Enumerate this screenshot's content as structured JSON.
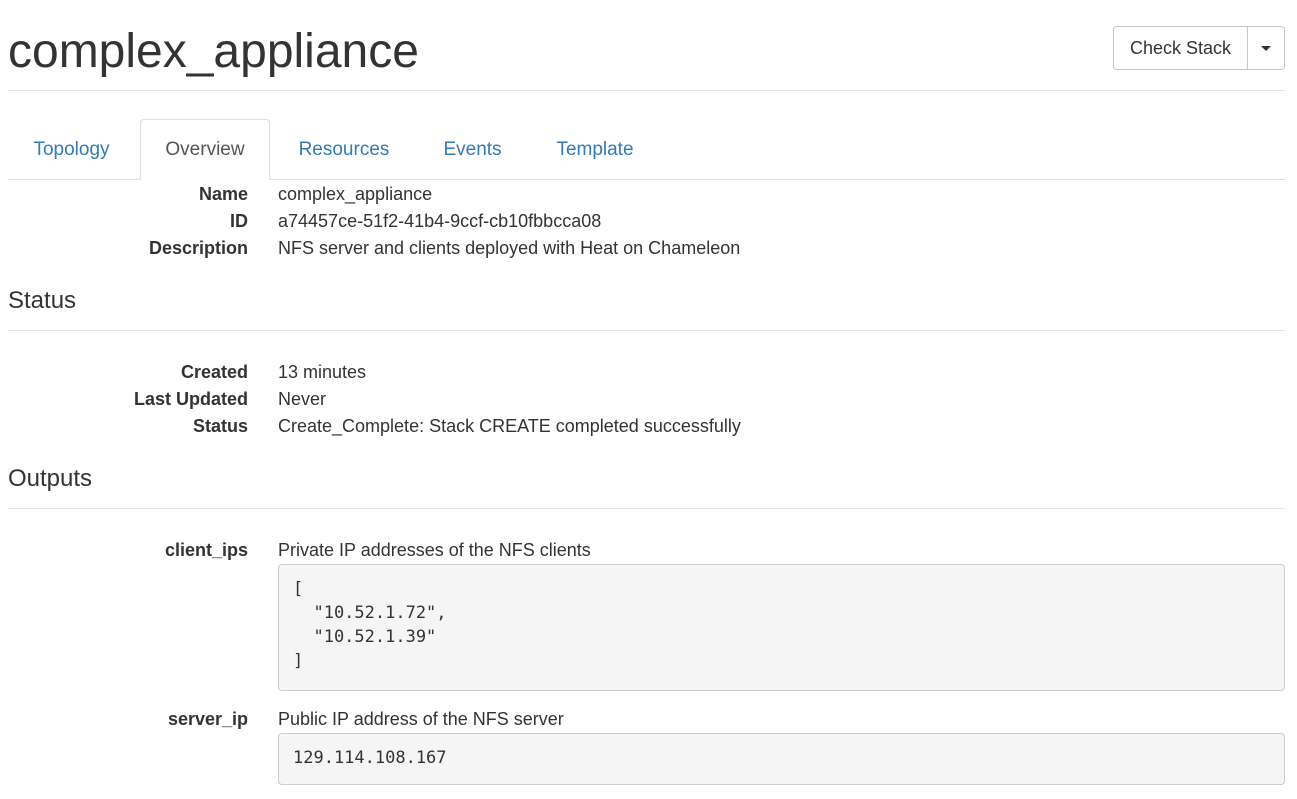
{
  "page": {
    "title": "complex_appliance"
  },
  "actions": {
    "check_stack_label": "Check Stack"
  },
  "tabs": [
    {
      "label": "Topology",
      "active": false
    },
    {
      "label": "Overview",
      "active": true
    },
    {
      "label": "Resources",
      "active": false
    },
    {
      "label": "Events",
      "active": false
    },
    {
      "label": "Template",
      "active": false
    }
  ],
  "info": {
    "name_label": "Name",
    "name": "complex_appliance",
    "id_label": "ID",
    "id": "a74457ce-51f2-41b4-9ccf-cb10fbbcca08",
    "description_label": "Description",
    "description": "NFS server and clients deployed with Heat on Chameleon"
  },
  "status_section": {
    "title": "Status",
    "created_label": "Created",
    "created": "13 minutes",
    "last_updated_label": "Last Updated",
    "last_updated": "Never",
    "status_label": "Status",
    "status": "Create_Complete: Stack CREATE completed successfully"
  },
  "outputs_section": {
    "title": "Outputs",
    "items": [
      {
        "key": "client_ips",
        "description": "Private IP addresses of the NFS clients",
        "value": "[\n  \"10.52.1.72\",\n  \"10.52.1.39\"\n]"
      },
      {
        "key": "server_ip",
        "description": "Public IP address of the NFS server",
        "value": "129.114.108.167"
      }
    ]
  },
  "colors": {
    "link": "#337ab7",
    "text": "#333333",
    "border": "#dddddd",
    "pre_bg": "#f5f5f5"
  }
}
